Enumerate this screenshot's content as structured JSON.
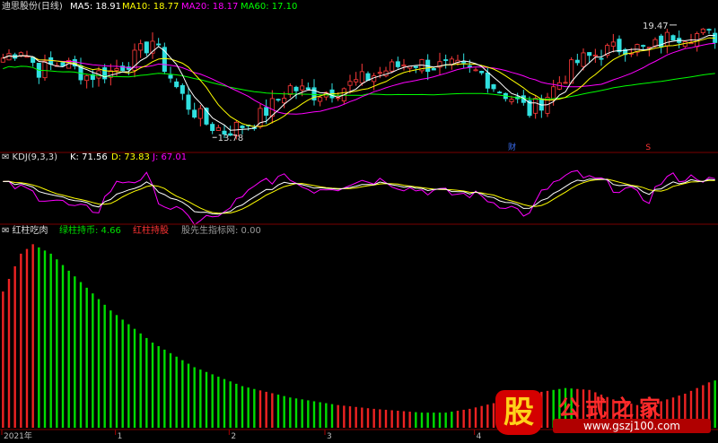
{
  "chart_data": [
    {
      "type": "candlestick",
      "title": "迪思股份(日线)",
      "indicators": [
        {
          "name": "MA5",
          "value": "18.91",
          "color": "#ffffff"
        },
        {
          "name": "MA10",
          "value": "18.77",
          "color": "#ffff00"
        },
        {
          "name": "MA20",
          "value": "18.17",
          "color": "#ff00ff"
        },
        {
          "name": "MA60",
          "value": "17.10",
          "color": "#00ff00"
        }
      ],
      "annotations": [
        {
          "label": "19.47",
          "x": 112,
          "y": 19.47
        },
        {
          "label": "13.78",
          "x": 35,
          "y": 13.78
        }
      ],
      "markers": [
        {
          "label": "财",
          "x": 85,
          "color": "#3a6df0"
        },
        {
          "label": "S",
          "x": 108,
          "color": "#ff3333"
        }
      ],
      "ylim": [
        13.2,
        20.1
      ],
      "price_path": [
        [
          0,
          17.8
        ],
        [
          3,
          18.3
        ],
        [
          6,
          17.2
        ],
        [
          10,
          17.6
        ],
        [
          14,
          16.9
        ],
        [
          18,
          17.1
        ],
        [
          22,
          17.8
        ],
        [
          25,
          18.7
        ],
        [
          27,
          17.4
        ],
        [
          29,
          16.3
        ],
        [
          31,
          15.4
        ],
        [
          34,
          14.5
        ],
        [
          37,
          14.1
        ],
        [
          39,
          14.3
        ],
        [
          42,
          14.6
        ],
        [
          45,
          15.4
        ],
        [
          48,
          16.3
        ],
        [
          52,
          16.0
        ],
        [
          56,
          16.2
        ],
        [
          60,
          16.7
        ],
        [
          64,
          17.2
        ],
        [
          68,
          17.6
        ],
        [
          72,
          17.4
        ],
        [
          76,
          17.3
        ],
        [
          80,
          17.0
        ],
        [
          82,
          16.4
        ],
        [
          85,
          15.8
        ],
        [
          88,
          15.1
        ],
        [
          90,
          15.6
        ],
        [
          93,
          16.6
        ],
        [
          96,
          17.6
        ],
        [
          100,
          18.1
        ],
        [
          104,
          18.4
        ],
        [
          108,
          18.2
        ],
        [
          112,
          19.0
        ],
        [
          116,
          19.0
        ],
        [
          119,
          18.9
        ]
      ],
      "ma_colors": {
        "ma5": "#ffffff",
        "ma10": "#ffff00",
        "ma20": "#ff00ff",
        "ma60": "#00ff00"
      }
    },
    {
      "type": "line",
      "title": "KDJ(9,3,3)",
      "series": [
        {
          "name": "K",
          "value": "71.56",
          "color": "#ffffff"
        },
        {
          "name": "D",
          "value": "73.83",
          "color": "#ffff00"
        },
        {
          "name": "J",
          "value": "67.01",
          "color": "#ff00ff"
        }
      ],
      "ylim": [
        0,
        100
      ],
      "k_path": [
        [
          0,
          68
        ],
        [
          4,
          62
        ],
        [
          8,
          48
        ],
        [
          12,
          35
        ],
        [
          16,
          28
        ],
        [
          20,
          52
        ],
        [
          24,
          66
        ],
        [
          28,
          42
        ],
        [
          32,
          20
        ],
        [
          36,
          12
        ],
        [
          40,
          28
        ],
        [
          44,
          55
        ],
        [
          48,
          68
        ],
        [
          52,
          60
        ],
        [
          56,
          58
        ],
        [
          60,
          64
        ],
        [
          64,
          68
        ],
        [
          68,
          60
        ],
        [
          72,
          55
        ],
        [
          76,
          52
        ],
        [
          80,
          48
        ],
        [
          84,
          36
        ],
        [
          88,
          22
        ],
        [
          92,
          48
        ],
        [
          96,
          70
        ],
        [
          100,
          72
        ],
        [
          104,
          62
        ],
        [
          108,
          50
        ],
        [
          112,
          66
        ],
        [
          116,
          72
        ],
        [
          119,
          70
        ]
      ]
    },
    {
      "type": "bar",
      "title": "红柱吃肉",
      "legend": [
        {
          "label": "绿柱持币: 4.66",
          "color": "#00e000"
        },
        {
          "label": "红柱持股",
          "color": "#ff3333"
        },
        {
          "label": "股先生指标网: 0.00",
          "color": "#999999"
        }
      ],
      "x_tick_labels": [
        "2021年",
        "1",
        "2",
        "3",
        "4"
      ],
      "ylim": [
        0,
        100
      ],
      "profile": [
        [
          0,
          72
        ],
        [
          3,
          92
        ],
        [
          5,
          97
        ],
        [
          8,
          92
        ],
        [
          12,
          80
        ],
        [
          18,
          62
        ],
        [
          25,
          45
        ],
        [
          32,
          32
        ],
        [
          40,
          22
        ],
        [
          48,
          16
        ],
        [
          56,
          12
        ],
        [
          62,
          10
        ],
        [
          66,
          9
        ],
        [
          70,
          8
        ],
        [
          74,
          8
        ],
        [
          78,
          10
        ],
        [
          82,
          13
        ],
        [
          86,
          16
        ],
        [
          90,
          19
        ],
        [
          94,
          21
        ],
        [
          98,
          20
        ],
        [
          102,
          15
        ],
        [
          106,
          12
        ],
        [
          110,
          14
        ],
        [
          114,
          18
        ],
        [
          118,
          24
        ],
        [
          120,
          26
        ]
      ],
      "red_ranges": [
        [
          0,
          5
        ],
        [
          43,
          45
        ],
        [
          56,
          68
        ],
        [
          76,
          91
        ],
        [
          96,
          118
        ]
      ],
      "colors": {
        "green": "#00dd00",
        "red": "#ee2222"
      }
    }
  ],
  "watermark": {
    "icon_text": "股",
    "name": "公式之家",
    "url": "www.gszj100.com"
  }
}
